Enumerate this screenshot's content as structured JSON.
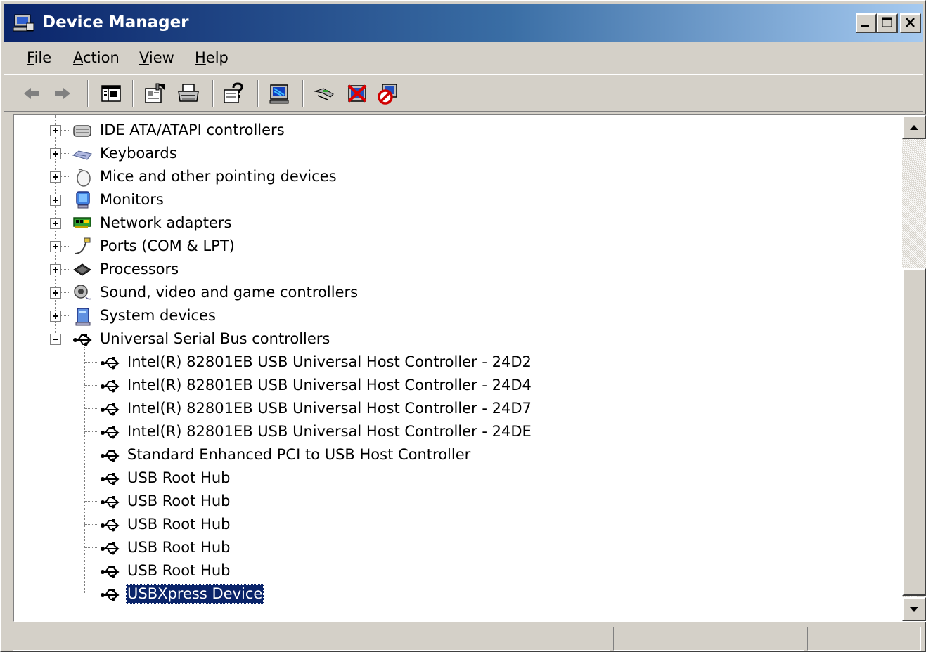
{
  "window": {
    "title": "Device Manager"
  },
  "menu": [
    {
      "label": "File",
      "key": "F",
      "rest": "ile"
    },
    {
      "label": "Action",
      "key": "A",
      "rest": "ction"
    },
    {
      "label": "View",
      "key": "V",
      "rest": "iew"
    },
    {
      "label": "Help",
      "key": "H",
      "rest": "elp"
    }
  ],
  "toolbar": {
    "buttons": [
      "back-icon",
      "forward-icon",
      "show-hide-tree-icon",
      "properties-icon",
      "print-icon",
      "help-icon",
      "scan-hardware-icon",
      "update-driver-icon",
      "uninstall-icon",
      "disable-icon"
    ]
  },
  "tree": {
    "categories": [
      {
        "label": "IDE ATA/ATAPI controllers",
        "icon": "ide-controller-icon",
        "expanded": false
      },
      {
        "label": "Keyboards",
        "icon": "keyboard-icon",
        "expanded": false
      },
      {
        "label": "Mice and other pointing devices",
        "icon": "mouse-icon",
        "expanded": false
      },
      {
        "label": "Monitors",
        "icon": "monitor-icon",
        "expanded": false
      },
      {
        "label": "Network adapters",
        "icon": "network-adapter-icon",
        "expanded": false
      },
      {
        "label": "Ports (COM & LPT)",
        "icon": "port-icon",
        "expanded": false
      },
      {
        "label": "Processors",
        "icon": "processor-icon",
        "expanded": false
      },
      {
        "label": "Sound, video and game controllers",
        "icon": "sound-icon",
        "expanded": false
      },
      {
        "label": "System devices",
        "icon": "system-device-icon",
        "expanded": false
      },
      {
        "label": "Universal Serial Bus controllers",
        "icon": "usb-icon",
        "expanded": true
      }
    ],
    "usb_children": [
      {
        "label": "Intel(R) 82801EB USB Universal Host Controller - 24D2"
      },
      {
        "label": "Intel(R) 82801EB USB Universal Host Controller - 24D4"
      },
      {
        "label": "Intel(R) 82801EB USB Universal Host Controller - 24D7"
      },
      {
        "label": "Intel(R) 82801EB USB Universal Host Controller - 24DE"
      },
      {
        "label": "Standard Enhanced PCI to USB Host Controller"
      },
      {
        "label": "USB Root Hub"
      },
      {
        "label": "USB Root Hub"
      },
      {
        "label": "USB Root Hub"
      },
      {
        "label": "USB Root Hub"
      },
      {
        "label": "USB Root Hub"
      },
      {
        "label": "USBXpress Device",
        "selected": true
      }
    ]
  },
  "colors": {
    "titlebar_start": "#0a246a",
    "titlebar_end": "#a6caf0",
    "selection": "#0a246a",
    "face": "#d4d0c8"
  }
}
